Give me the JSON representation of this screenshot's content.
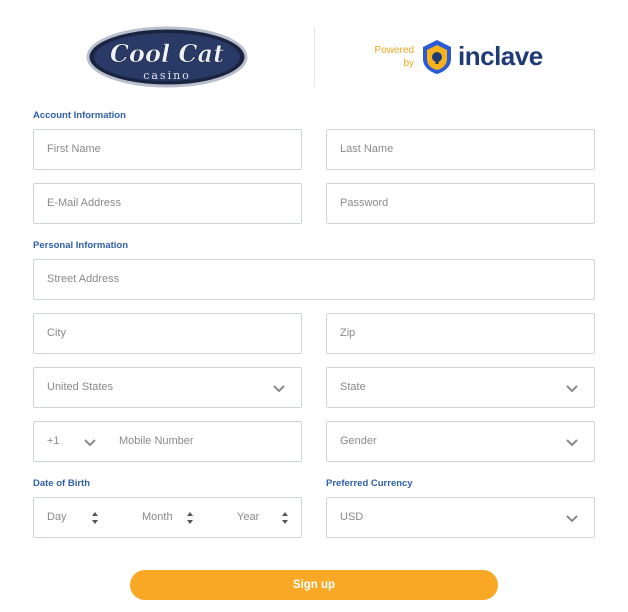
{
  "header": {
    "casino_logo_line1": "Cool Cat",
    "casino_logo_line2": "casino",
    "powered_line1": "Powered",
    "powered_line2": "by",
    "brand_name": "inclave",
    "colors": {
      "accent_orange": "#f9a826",
      "brand_blue": "#1f3b73",
      "label_blue": "#2f5fa8"
    }
  },
  "sections": {
    "account": "Account Information",
    "personal": "Personal Information",
    "dob": "Date of Birth",
    "currency": "Preferred Currency"
  },
  "fields": {
    "first_name": "First Name",
    "last_name": "Last Name",
    "email": "E-Mail Address",
    "password": "Password",
    "street": "Street Address",
    "city": "City",
    "zip": "Zip",
    "country": "United States",
    "state": "State",
    "phone_code": "+1",
    "mobile": "Mobile Number",
    "gender": "Gender",
    "day": "Day",
    "month": "Month",
    "year": "Year",
    "currency": "USD"
  },
  "actions": {
    "signup": "Sign up"
  }
}
